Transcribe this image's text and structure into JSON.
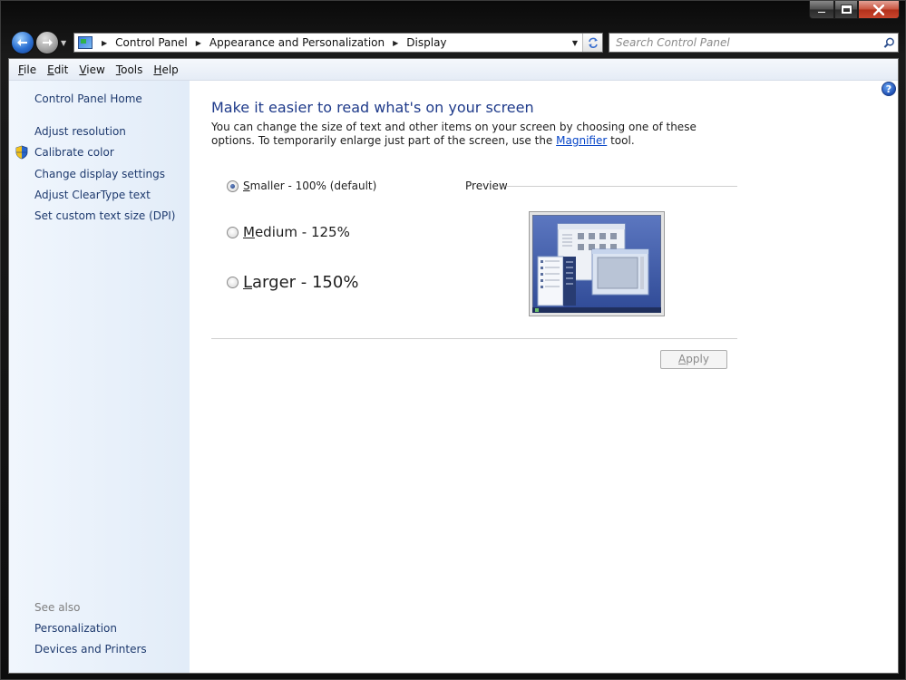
{
  "window": {
    "caption": {
      "minimize_glyph": "—",
      "maximize_glyph": "□",
      "close_glyph": "✕"
    }
  },
  "address_bar": {
    "crumbs": [
      "Control Panel",
      "Appearance and Personalization",
      "Display"
    ]
  },
  "search": {
    "placeholder": "Search Control Panel"
  },
  "menubar": {
    "items": [
      {
        "label": "File",
        "mnemonic": "F",
        "rest": "ile"
      },
      {
        "label": "Edit",
        "mnemonic": "E",
        "rest": "dit"
      },
      {
        "label": "View",
        "mnemonic": "V",
        "rest": "iew"
      },
      {
        "label": "Tools",
        "mnemonic": "T",
        "rest": "ools"
      },
      {
        "label": "Help",
        "mnemonic": "H",
        "rest": "elp"
      }
    ]
  },
  "sidebar": {
    "home": "Control Panel Home",
    "tasks": [
      "Adjust resolution",
      "Calibrate color",
      "Change display settings",
      "Adjust ClearType text",
      "Set custom text size (DPI)"
    ],
    "see_also_heading": "See also",
    "see_also": [
      "Personalization",
      "Devices and Printers"
    ]
  },
  "main": {
    "title": "Make it easier to read what's on your screen",
    "description_before": "You can change the size of text and other items on your screen by choosing one of these options. To temporarily enlarge just part of the screen, use the ",
    "magnifier_link": "Magnifier",
    "description_after": " tool.",
    "options": [
      {
        "mnemonic": "S",
        "rest": "maller - 100% (default)",
        "checked": true
      },
      {
        "mnemonic": "M",
        "rest": "edium - 125%",
        "checked": false
      },
      {
        "mnemonic": "L",
        "rest": "arger - 150%",
        "checked": false
      }
    ],
    "preview_label": "Preview",
    "apply": {
      "mnemonic": "A",
      "rest": "pply",
      "enabled": false
    }
  },
  "colors": {
    "accent_title": "#1e3a8a",
    "link": "#1e3a6e",
    "sidebar_bg": "#e2ecf8",
    "preview_desktop": "#3d5aa8"
  },
  "icons": {
    "back": "back-arrow-icon",
    "forward": "forward-arrow-icon",
    "refresh": "refresh-icon",
    "search": "search-icon",
    "help": "help-icon",
    "shield": "uac-shield-icon"
  }
}
